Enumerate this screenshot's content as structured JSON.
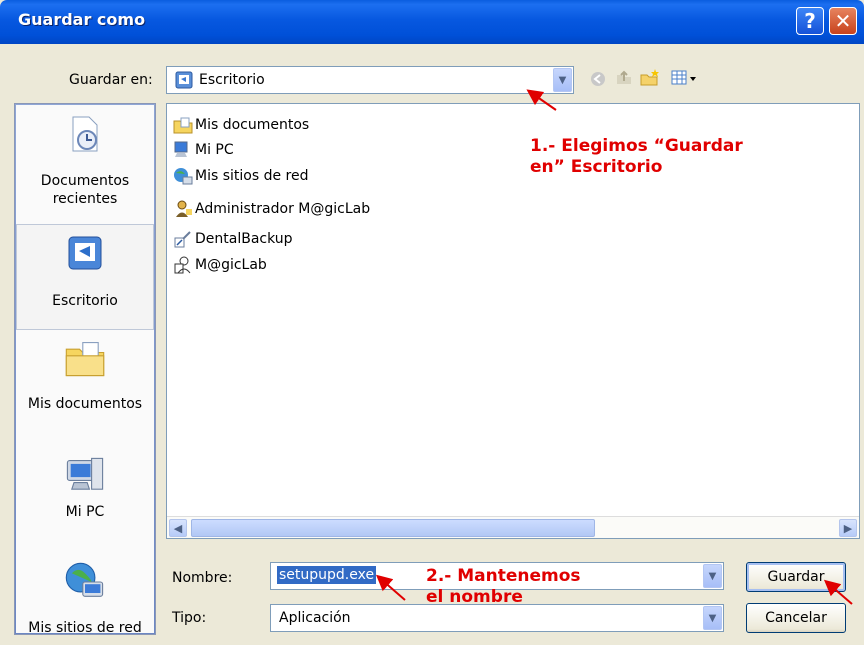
{
  "window": {
    "title": "Guardar como"
  },
  "toolbar": {
    "save_in_label": "Guardar en:",
    "save_in_value": "Escritorio"
  },
  "places": [
    {
      "label_lines": [
        "Documentos",
        "recientes"
      ]
    },
    {
      "label_lines": [
        "Escritorio"
      ]
    },
    {
      "label_lines": [
        "Mis documentos"
      ]
    },
    {
      "label_lines": [
        "Mi PC"
      ]
    },
    {
      "label_lines": [
        "Mis sitios de red"
      ]
    }
  ],
  "files": [
    {
      "name": "Mis documentos",
      "icon": "folder-documents-icon"
    },
    {
      "name": "Mi PC",
      "icon": "computer-icon"
    },
    {
      "name": "Mis sitios de red",
      "icon": "network-icon"
    },
    {
      "name": "Administrador M@gicLab",
      "icon": "user-folder-icon"
    },
    {
      "name": "DentalBackup",
      "icon": "shortcut-icon"
    },
    {
      "name": "M@gicLab",
      "icon": "user-folder-icon"
    }
  ],
  "form": {
    "name_label": "Nombre:",
    "name_value": "setupupd.exe",
    "type_label": "Tipo:",
    "type_value": "Aplicación",
    "save_button": "Guardar",
    "cancel_button": "Cancelar"
  },
  "annotations": {
    "a1_line1": "1.- Elegimos “Guardar",
    "a1_line2": "en” Escritorio",
    "a2_line1": "2.- Mantenemos",
    "a2_line2": "el nombre"
  },
  "colors": {
    "titlebar": "#0054e3",
    "annotation": "#e00000",
    "selection": "#316ac5"
  }
}
